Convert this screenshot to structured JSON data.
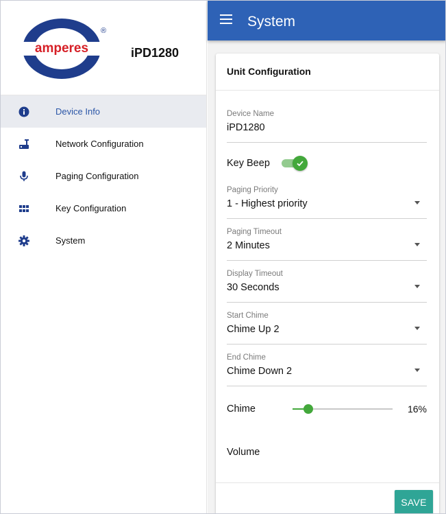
{
  "brand": {
    "logo_text": "amperes",
    "registered_mark": "®",
    "model": "iPD1280",
    "colors": {
      "ring": "#1f3d8c",
      "text": "#d61f26"
    }
  },
  "sidebar": {
    "items": [
      {
        "label": "Device Info",
        "icon": "info-icon",
        "active": true
      },
      {
        "label": "Network Configuration",
        "icon": "network-icon",
        "active": false
      },
      {
        "label": "Paging Configuration",
        "icon": "microphone-icon",
        "active": false
      },
      {
        "label": "Key Configuration",
        "icon": "keypad-grid-icon",
        "active": false
      },
      {
        "label": "System",
        "icon": "gear-icon",
        "active": false
      }
    ]
  },
  "appbar": {
    "title": "System",
    "color": "#2e62b6"
  },
  "card": {
    "title": "Unit Configuration",
    "device_name": {
      "label": "Device Name",
      "value": "iPD1280"
    },
    "key_beep": {
      "label": "Key Beep",
      "enabled": true
    },
    "paging_priority": {
      "label": "Paging Priority",
      "value": "1 - Highest priority"
    },
    "paging_timeout": {
      "label": "Paging Timeout",
      "value": "2 Minutes"
    },
    "display_timeout": {
      "label": "Display Timeout",
      "value": "30 Seconds"
    },
    "start_chime": {
      "label": "Start Chime",
      "value": "Chime Up 2"
    },
    "end_chime": {
      "label": "End Chime",
      "value": "Chime Down 2"
    },
    "chime_volume": {
      "label": "Chime",
      "value_text": "16%",
      "value": 16
    },
    "volume_label": "Volume",
    "save_label": "SAVE"
  },
  "colors": {
    "accent_green": "#43a83b",
    "save_teal": "#2fa596",
    "active_nav_text": "#2b56a7"
  }
}
